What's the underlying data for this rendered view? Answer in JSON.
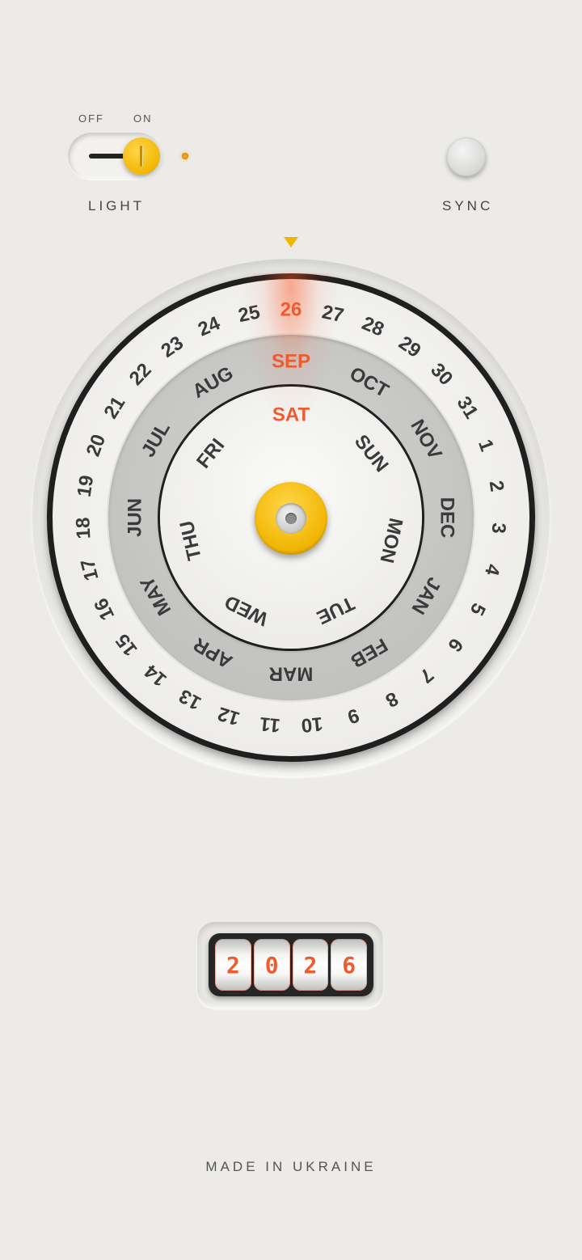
{
  "light_switch": {
    "off_label": "OFF",
    "on_label": "ON",
    "label": "LIGHT",
    "state": "on"
  },
  "sync": {
    "label": "SYNC"
  },
  "dial": {
    "selected_date": "26",
    "selected_month": "SEP",
    "selected_weekday": "SAT",
    "highlight_color": "#ef5b2e",
    "accent_color": "#f2b705",
    "dates": [
      "1",
      "2",
      "3",
      "4",
      "5",
      "6",
      "7",
      "8",
      "9",
      "10",
      "11",
      "12",
      "13",
      "14",
      "15",
      "16",
      "17",
      "18",
      "19",
      "20",
      "21",
      "22",
      "23",
      "24",
      "25",
      "26",
      "27",
      "28",
      "29",
      "30",
      "31"
    ],
    "months": [
      "JAN",
      "FEB",
      "MAR",
      "APR",
      "MAY",
      "JUN",
      "JUL",
      "AUG",
      "SEP",
      "OCT",
      "NOV",
      "DEC"
    ],
    "weekdays": [
      "SUN",
      "MON",
      "TUE",
      "WED",
      "THU",
      "FRI",
      "SAT"
    ]
  },
  "year": {
    "digits": [
      "2",
      "0",
      "2",
      "6"
    ]
  },
  "footer": {
    "text": "MADE IN UKRAINE"
  }
}
